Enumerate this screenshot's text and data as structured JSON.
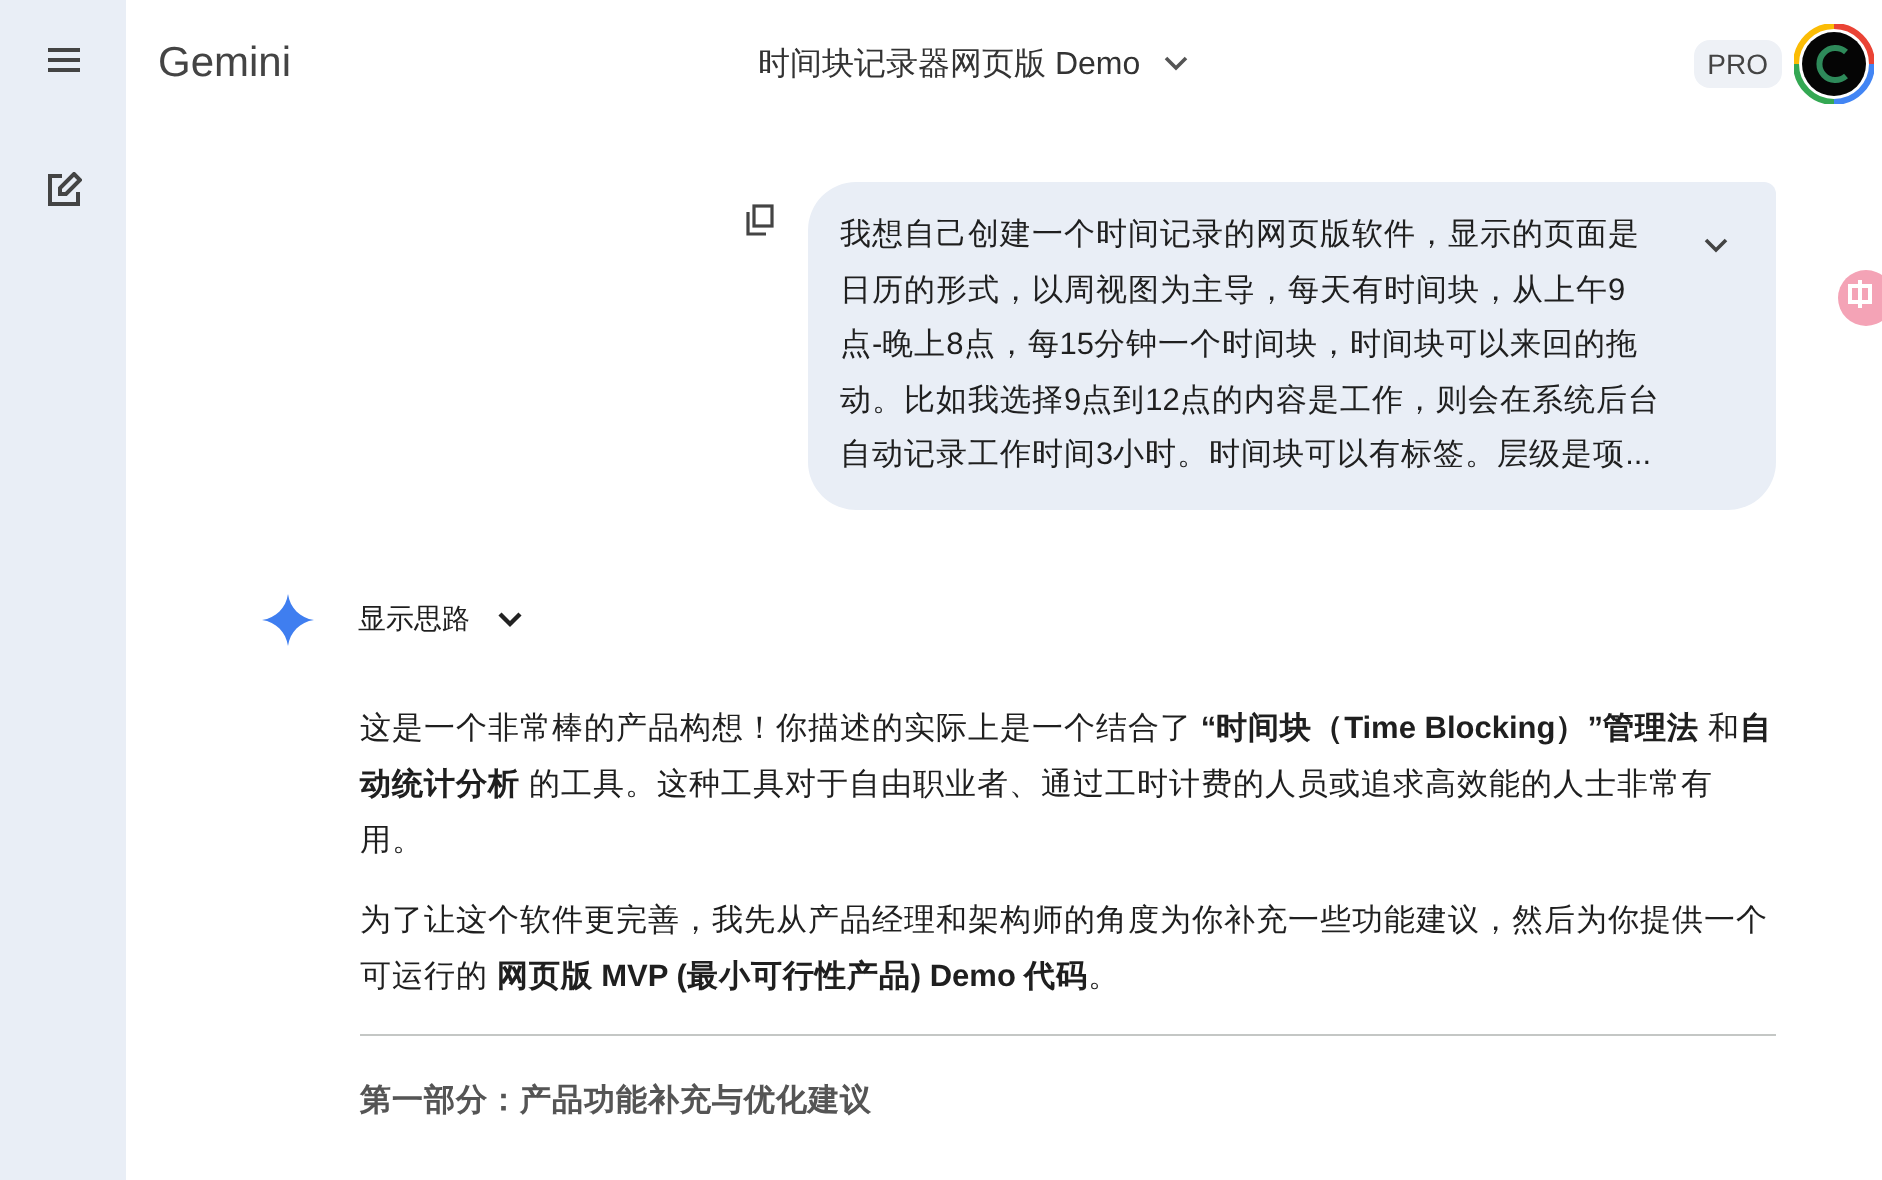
{
  "app_title": "Gemini",
  "chat_title": "时间块记录器网页版 Demo",
  "plan_badge": "PRO",
  "user_message": {
    "lines": [
      "我想自己创建一个时间记录的网页版软件，显示的页面是",
      "日历的形式，以周视图为主导，每天有时间块，从上午9",
      "点-晚上8点，每15分钟一个时间块，时间块可以来回的拖",
      "动。比如我选择9点到12点的内容是工作，则会在系统后台",
      "自动记录工作时间3小时。时间块可以有标签。层级是项..."
    ],
    "expanded": false
  },
  "thinking_toggle": {
    "label": "显示思路",
    "expanded": false
  },
  "response": {
    "paragraphs": [
      "这是一个非常棒的产品构想！你描述的实际上是一个结合了 **“时间块（Time Blocking）”管理法** 和**自动统计分析** 的工具。这种工具对于自由职业者、通过工时计费的人员或追求高效能的人士非常有用。",
      "为了让这个软件更完善，我先从产品经理和架构师的角度为你补充一些功能建议，然后为你提供一个可运行的 **网页版 MVP (最小可行性产品) Demo 代码**。"
    ],
    "heading": "第一部分：产品功能补充与优化建议"
  }
}
